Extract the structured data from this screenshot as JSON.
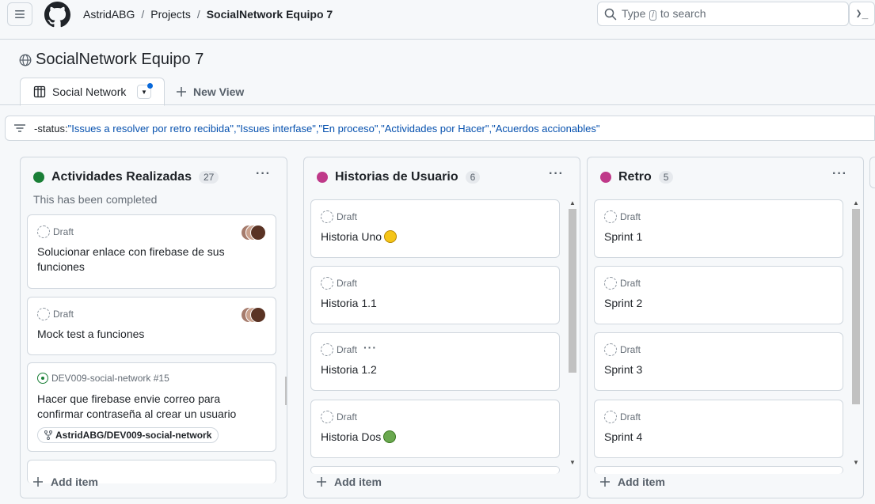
{
  "header": {
    "breadcrumb": [
      "AstridABG",
      "Projects",
      "SocialNetwork Equipo 7"
    ],
    "search_prefix": "Type",
    "search_key": "/",
    "search_suffix": "to search",
    "command_glyph": "❯_"
  },
  "project": {
    "title": "SocialNetwork Equipo 7",
    "active_tab": "Social Network",
    "new_view": "New View"
  },
  "filter": {
    "prefix": "-status:",
    "query": "\"Issues a resolver por retro recibida\",\"Issues interfase\",\"En proceso\",\"Actividades por Hacer\",\"Acuerdos accionables\""
  },
  "colors": {
    "green": "#1a7f37",
    "pink": "#bf3989",
    "accent": "#0969da"
  },
  "columns": [
    {
      "name": "Actividades Realizadas",
      "count": "27",
      "color": "#1a7f37",
      "description": "This has been completed",
      "add_label": "Add item",
      "cards": [
        {
          "kind": "draft",
          "status": "Draft",
          "title": "Solucionar enlace con firebase de sus funciones",
          "assignees": true
        },
        {
          "kind": "draft",
          "status": "Draft",
          "title": "Mock test a funciones",
          "assignees": true
        },
        {
          "kind": "issue",
          "ref": "DEV009-social-network #15",
          "title": "Hacer que firebase envie correo para confirmar contraseña al crear un usuario",
          "repo": "AstridABG/DEV009-social-network"
        }
      ]
    },
    {
      "name": "Historias de Usuario",
      "count": "6",
      "color": "#bf3989",
      "add_label": "Add item",
      "cards": [
        {
          "status": "Draft",
          "title": "Historia Uno",
          "emoji": "smiley-icon"
        },
        {
          "status": "Draft",
          "title": "Historia 1.1"
        },
        {
          "status": "Draft",
          "title": "Historia 1.2",
          "menu": "···"
        },
        {
          "status": "Draft",
          "title": "Historia Dos",
          "emoji": "alien-icon"
        }
      ]
    },
    {
      "name": "Retro",
      "count": "5",
      "color": "#bf3989",
      "add_label": "Add item",
      "cards": [
        {
          "status": "Draft",
          "title": "Sprint 1"
        },
        {
          "status": "Draft",
          "title": "Sprint 2"
        },
        {
          "status": "Draft",
          "title": "Sprint 3"
        },
        {
          "status": "Draft",
          "title": "Sprint 4"
        }
      ]
    }
  ]
}
